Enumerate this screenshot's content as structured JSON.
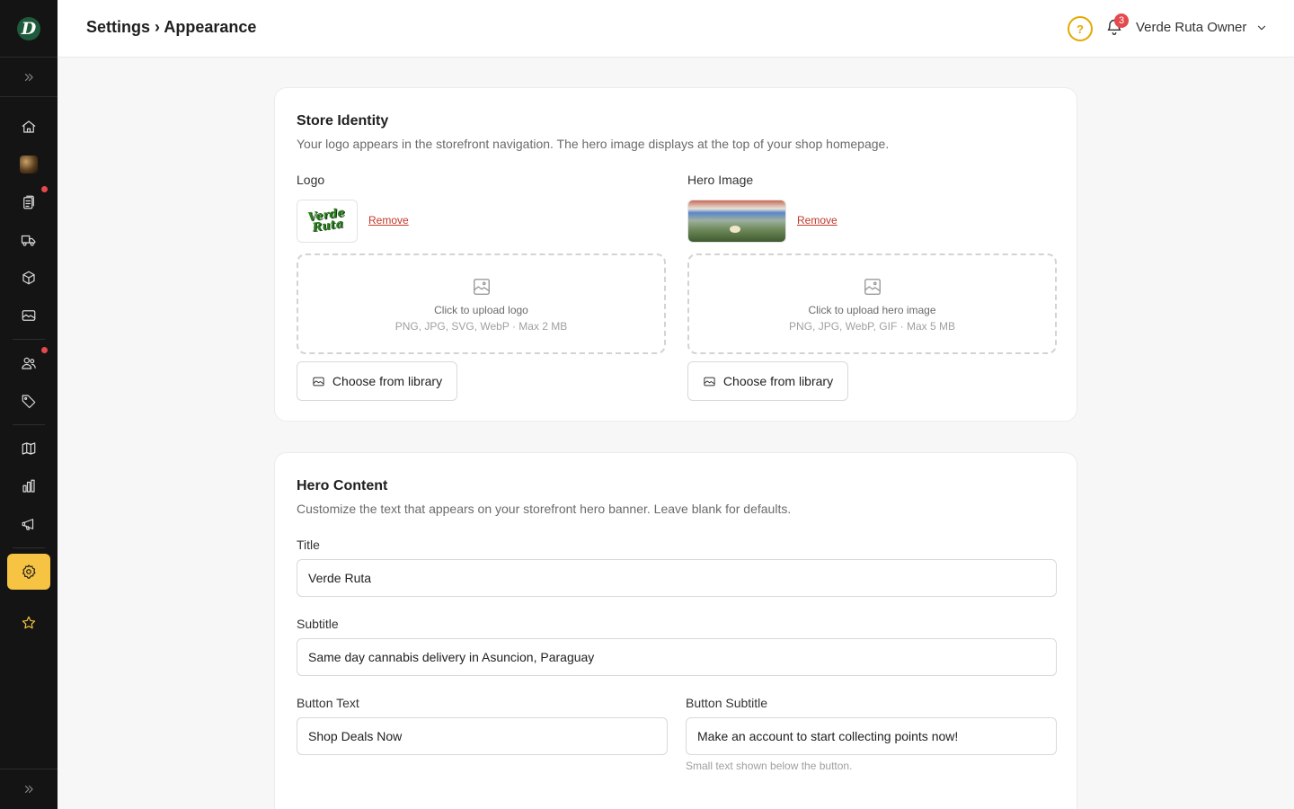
{
  "header": {
    "breadcrumb": "Settings › Appearance",
    "help_label": "?",
    "notifications_count": "3",
    "user_name": "Verde Ruta Owner"
  },
  "sidebar": {
    "logo_letter": "D",
    "active_item": "settings",
    "items": [
      {
        "id": "home",
        "icon": "home-icon"
      },
      {
        "id": "product-image",
        "icon": "thumbnail"
      },
      {
        "id": "orders",
        "icon": "clipboard-icon",
        "has_alert": true
      },
      {
        "id": "delivery",
        "icon": "truck-icon"
      },
      {
        "id": "products",
        "icon": "box-icon"
      },
      {
        "id": "media",
        "icon": "image-icon"
      },
      {
        "id": "customers",
        "icon": "users-icon",
        "has_alert": true
      },
      {
        "id": "promotions",
        "icon": "tag-icon"
      },
      {
        "id": "catalog",
        "icon": "map-icon"
      },
      {
        "id": "analytics",
        "icon": "bar-chart-icon"
      },
      {
        "id": "marketing",
        "icon": "megaphone-icon"
      },
      {
        "id": "settings",
        "icon": "gear-icon"
      },
      {
        "id": "loyalty",
        "icon": "star-icon"
      }
    ]
  },
  "store_identity": {
    "title": "Store Identity",
    "description": "Your logo appears in the storefront navigation. The hero image displays at the top of your shop homepage.",
    "logo": {
      "label": "Logo",
      "logo_text": "Verde Ruta",
      "remove_label": "Remove",
      "upload_title": "Click to upload logo",
      "upload_hint": "PNG, JPG, SVG, WebP · Max 2 MB",
      "library_label": "Choose from library"
    },
    "hero": {
      "label": "Hero Image",
      "remove_label": "Remove",
      "upload_title": "Click to upload hero image",
      "upload_hint": "PNG, JPG, WebP, GIF · Max 5 MB",
      "library_label": "Choose from library"
    }
  },
  "hero_content": {
    "title": "Hero Content",
    "description": "Customize the text that appears on your storefront hero banner. Leave blank for defaults.",
    "fields": {
      "title_label": "Title",
      "title_value": "Verde Ruta",
      "subtitle_label": "Subtitle",
      "subtitle_value": "Same day cannabis delivery in Asuncion, Paraguay",
      "button_text_label": "Button Text",
      "button_text_value": "Shop Deals Now",
      "button_subtitle_label": "Button Subtitle",
      "button_subtitle_value": "Make an account to start collecting points now!",
      "button_subtitle_helper": "Small text shown below the button."
    }
  },
  "colors": {
    "accent": "#f6c343",
    "sidebar_bg": "#141414",
    "danger": "#e5484d",
    "link_danger": "#c0392b"
  }
}
